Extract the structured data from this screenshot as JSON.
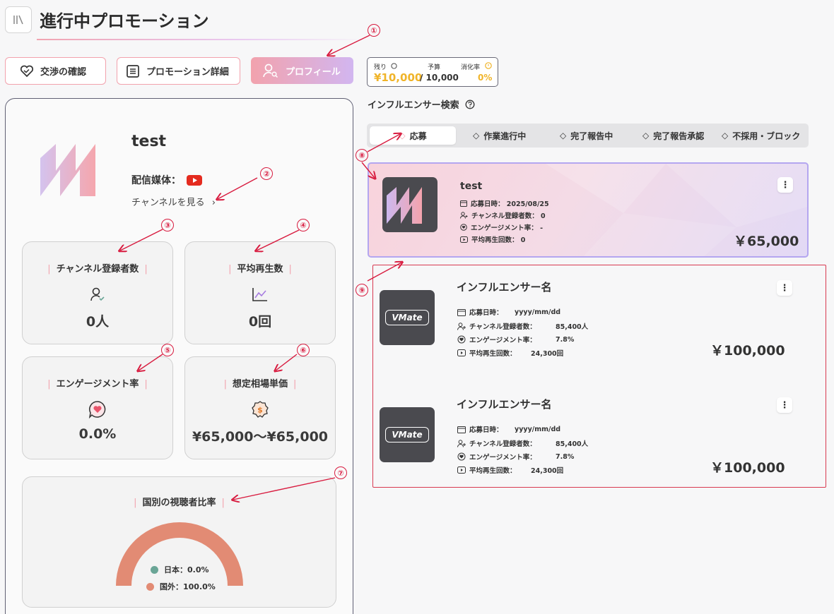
{
  "header": {
    "title": "進行中プロモーション"
  },
  "tabs": {
    "negotiation": "交渉の確認",
    "details": "プロモーション詳細",
    "profile": "プロフィール"
  },
  "budget": {
    "remaining_label": "残り",
    "remaining_value": "¥10,000",
    "budget_label": "予算",
    "budget_value": "/ 10,000",
    "rate_label": "消化率",
    "rate_value": "0%"
  },
  "search": {
    "title": "インフルエンサー検索"
  },
  "status_tabs": [
    "応募",
    "作業進行中",
    "完了報告中",
    "完了報告承認",
    "不採用・ブロック"
  ],
  "profile": {
    "name": "test",
    "media_label": "配信媒体：",
    "channel_link": "チャンネルを見る",
    "stats": [
      {
        "label": "チャンネル登録者数",
        "value": "0人",
        "icon": "user-check-icon"
      },
      {
        "label": "平均再生数",
        "value": "0回",
        "icon": "line-chart-icon"
      },
      {
        "label": "エンゲージメント率",
        "value": "0.0%",
        "icon": "heart-bubble-icon"
      },
      {
        "label": "想定相場単価",
        "value": "¥65,000～¥65,000",
        "icon": "dollar-badge-icon"
      }
    ],
    "country": {
      "title": "国別の視聴者比率",
      "legend": [
        {
          "label": "日本：0.0%",
          "color": "#6aa596"
        },
        {
          "label": "国外：100.0%",
          "color": "#e28b74"
        }
      ]
    }
  },
  "chart_data": {
    "type": "pie",
    "title": "国別の視聴者比率",
    "categories": [
      "日本",
      "国外"
    ],
    "values": [
      0.0,
      100.0
    ],
    "colors": [
      "#6aa596",
      "#e28b74"
    ]
  },
  "cards": [
    {
      "name": "test",
      "date": "応募日時： 2025/08/25",
      "subs": "チャンネル登録者数： 0",
      "engagement": "エンゲージメント率： -",
      "views": "平均再生回数： 0",
      "price": "￥65,000"
    },
    {
      "name": "インフルエンサー名",
      "date_label": "応募日時：",
      "date_value": "yyyy/mm/dd",
      "subs_label": "チャンネル登録者数：",
      "subs_value": "85,400人",
      "engagement_label": "エンゲージメント率：",
      "engagement_value": "7.8%",
      "views_label": "平均再生回数：",
      "views_value": "24,300回",
      "price": "￥100,000",
      "logo_text": "VMate"
    },
    {
      "name": "インフルエンサー名",
      "date_label": "応募日時：",
      "date_value": "yyyy/mm/dd",
      "subs_label": "チャンネル登録者数：",
      "subs_value": "85,400人",
      "engagement_label": "エンゲージメント率：",
      "engagement_value": "7.8%",
      "views_label": "平均再生回数：",
      "views_value": "24,300回",
      "price": "￥100,000",
      "logo_text": "VMate"
    }
  ],
  "annotations": [
    "①",
    "②",
    "③",
    "④",
    "⑤",
    "⑥",
    "⑦",
    "⑧",
    "⑨"
  ],
  "colors": {
    "accent_pink": "#f2a2ad",
    "accent_purple": "#d2b6f0",
    "annotation_red": "#d81b3f",
    "budget_gold": "#f0b429"
  }
}
